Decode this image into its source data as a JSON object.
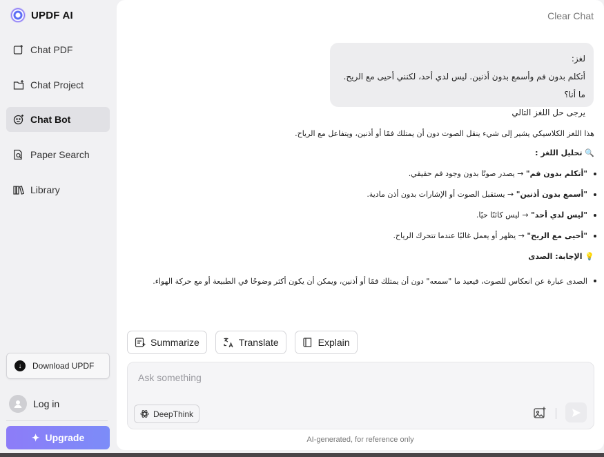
{
  "app": {
    "name": "UPDF AI"
  },
  "sidebar": {
    "items": [
      {
        "label": "Chat PDF",
        "icon": "chat-pdf-icon"
      },
      {
        "label": "Chat Project",
        "icon": "chat-project-icon"
      },
      {
        "label": "Chat Bot",
        "icon": "chat-bot-icon",
        "active": true
      },
      {
        "label": "Paper Search",
        "icon": "paper-search-icon"
      },
      {
        "label": "Library",
        "icon": "library-icon"
      }
    ],
    "download_label": "Download UPDF",
    "login_label": "Log in",
    "upgrade_label": "Upgrade"
  },
  "header": {
    "clear_chat": "Clear Chat"
  },
  "conversation": {
    "user_message": {
      "line1": "لغز:",
      "line2": "أتكلم بدون فم وأسمع بدون أذنين. ليس لدي أحد، لكنني أحيى مع الريح. ما أنا؟",
      "line3": "يرجى حل اللغز التالي"
    },
    "answer": {
      "intro": "هذا اللغز الكلاسيكي يشير إلى شيء ينقل الصوت دون أن يمتلك فمًا أو أذنين، ويتفاعل مع الرياح.",
      "analysis_heading": "🔍 تحليل اللغز :",
      "points": [
        {
          "bold": "\"أتكلم بدون فم\"",
          "rest": " → يصدر صوتًا بدون وجود فم حقيقي."
        },
        {
          "bold": "\"أسمع بدون أذنين\"",
          "rest": " → يستقبل الصوت أو الإشارات بدون أذن مادية."
        },
        {
          "bold": "\"ليس لدي أحد\"",
          "rest": " → ليس كائنًا حيًا."
        },
        {
          "bold": "\"أحيى مع الريح\"",
          "rest": " → يظهر أو يعمل غالبًا عندما تتحرك الرياح."
        }
      ],
      "answer_heading": "💡 الإجابة: الصدى",
      "final": "الصدى عبارة عن انعكاس للصوت، فيعيد ما \"سمعه\" دون أن يمتلك فمًا أو أذنين، ويمكن أن يكون أكثر وضوحًا في الطبيعة أو مع حركة الهواء."
    }
  },
  "actions": {
    "summarize": "Summarize",
    "translate": "Translate",
    "explain": "Explain"
  },
  "composer": {
    "placeholder": "Ask something",
    "deepthink_label": "DeepThink"
  },
  "footer_note": "AI-generated, for reference only",
  "colors": {
    "accent": "#8d7cf8",
    "sidebar_bg": "#f1f1f3",
    "active_item_bg": "#e1e1e5",
    "bubble_bg": "#ededef"
  }
}
